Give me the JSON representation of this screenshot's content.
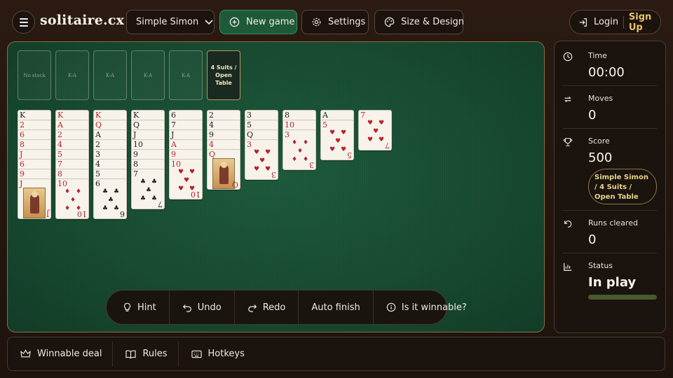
{
  "header": {
    "logo": "solitaire.cx",
    "game_select": "Simple Simon",
    "new_game": "New game",
    "settings": "Settings",
    "size_design": "Size & Design",
    "login": "Login",
    "signup": "Sign Up"
  },
  "board": {
    "slots": [
      "No stock",
      "K-A",
      "K-A",
      "K-A",
      "K-A"
    ],
    "mode": "4 Suits / Open Table",
    "columns": [
      {
        "cards": [
          [
            "K",
            "blk"
          ],
          [
            "2",
            "red"
          ],
          [
            "6",
            "red"
          ],
          [
            "8",
            "red"
          ],
          [
            "J",
            "red"
          ],
          [
            "6",
            "red"
          ],
          [
            "9",
            "red"
          ],
          [
            "J",
            "red"
          ]
        ],
        "top_face": true
      },
      {
        "cards": [
          [
            "K",
            "red"
          ],
          [
            "A",
            "red"
          ],
          [
            "2",
            "red"
          ],
          [
            "4",
            "red"
          ],
          [
            "5",
            "red"
          ],
          [
            "7",
            "red"
          ],
          [
            "8",
            "red"
          ],
          [
            "10",
            "red"
          ]
        ],
        "top_pips": "♦"
      },
      {
        "cards": [
          [
            "K",
            "red"
          ],
          [
            "Q",
            "red"
          ],
          [
            "A",
            "blk"
          ],
          [
            "2",
            "blk"
          ],
          [
            "3",
            "blk"
          ],
          [
            "4",
            "blk"
          ],
          [
            "5",
            "blk"
          ],
          [
            "6",
            "blk"
          ]
        ],
        "top_pips": "♣"
      },
      {
        "cards": [
          [
            "K",
            "blk"
          ],
          [
            "Q",
            "blk"
          ],
          [
            "J",
            "blk"
          ],
          [
            "10",
            "blk"
          ],
          [
            "9",
            "blk"
          ],
          [
            "8",
            "blk"
          ],
          [
            "7",
            "blk"
          ]
        ],
        "top_pips": "♣"
      },
      {
        "cards": [
          [
            "6",
            "blk"
          ],
          [
            "7",
            "blk"
          ],
          [
            "J",
            "blk"
          ],
          [
            "A",
            "red"
          ],
          [
            "9",
            "red"
          ],
          [
            "10",
            "red"
          ]
        ],
        "top_pips": "♥"
      },
      {
        "cards": [
          [
            "2",
            "blk"
          ],
          [
            "4",
            "blk"
          ],
          [
            "9",
            "blk"
          ],
          [
            "4",
            "red"
          ],
          [
            "Q",
            "red"
          ]
        ],
        "top_face": true
      },
      {
        "cards": [
          [
            "3",
            "blk"
          ],
          [
            "5",
            "blk"
          ],
          [
            "Q",
            "blk"
          ],
          [
            "3",
            "red"
          ]
        ],
        "top_pips": "♥"
      },
      {
        "cards": [
          [
            "8",
            "blk"
          ],
          [
            "10",
            "red"
          ],
          [
            "3",
            "red"
          ]
        ],
        "top_pips": "♦"
      },
      {
        "cards": [
          [
            "A",
            "blk"
          ],
          [
            "5",
            "red"
          ]
        ],
        "top_pips": "♥"
      },
      {
        "cards": [
          [
            "7",
            "red"
          ]
        ],
        "top_pips": "♥"
      }
    ]
  },
  "actions": {
    "hint": "Hint",
    "undo": "Undo",
    "redo": "Redo",
    "auto_finish": "Auto finish",
    "winnable": "Is it winnable?"
  },
  "stats": {
    "time_label": "Time",
    "time_value": "00:00",
    "moves_label": "Moves",
    "moves_value": "0",
    "score_label": "Score",
    "score_value": "500",
    "mode_pill": "Simple Simon / 4 Suits / Open Table",
    "runs_label": "Runs cleared",
    "runs_value": "0",
    "status_label": "Status",
    "status_value": "In play"
  },
  "footer": {
    "winnable_deal": "Winnable deal",
    "rules": "Rules",
    "hotkeys": "Hotkeys"
  }
}
